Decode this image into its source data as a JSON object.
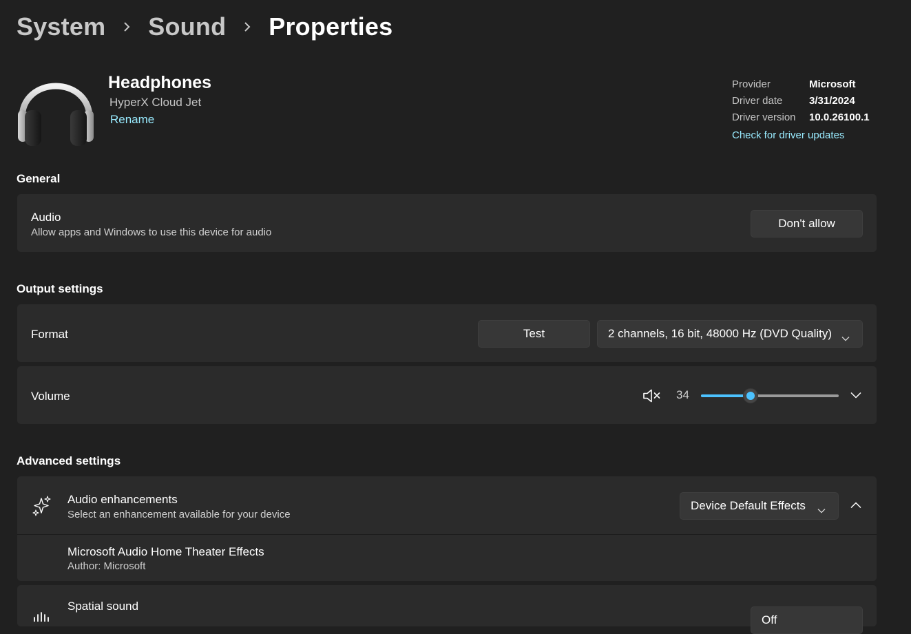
{
  "breadcrumb": {
    "items": [
      "System",
      "Sound",
      "Properties"
    ]
  },
  "device": {
    "name": "Headphones",
    "model": "HyperX Cloud Jet",
    "rename_label": "Rename"
  },
  "driver": {
    "provider_label": "Provider",
    "provider_value": "Microsoft",
    "date_label": "Driver date",
    "date_value": "3/31/2024",
    "version_label": "Driver version",
    "version_value": "10.0.26100.1",
    "update_link": "Check for driver updates"
  },
  "general": {
    "section_title": "General",
    "audio_title": "Audio",
    "audio_sub": "Allow apps and Windows to use this device for audio",
    "audio_button": "Don't allow"
  },
  "output": {
    "section_title": "Output settings",
    "format_label": "Format",
    "test_button": "Test",
    "format_value": "2 channels, 16 bit, 48000 Hz (DVD Quality)",
    "volume_label": "Volume",
    "volume_value": "34",
    "volume_level": 0.34
  },
  "advanced": {
    "section_title": "Advanced settings",
    "enh_title": "Audio enhancements",
    "enh_sub": "Select an enhancement available for your device",
    "enh_value": "Device Default Effects",
    "effect_title": "Microsoft Audio Home Theater Effects",
    "effect_sub": "Author: Microsoft",
    "spatial_title": "Spatial sound",
    "spatial_value": "Off"
  },
  "colors": {
    "background": "#202020",
    "card": "#2b2b2b",
    "accent": "#4cc2ff",
    "link": "#99ebff"
  },
  "icons": [
    "chevron-right-icon",
    "headphones-icon",
    "speaker-muted-icon",
    "chevron-down-icon",
    "chevron-up-icon",
    "sparkle-icon",
    "spatial-sound-icon"
  ]
}
